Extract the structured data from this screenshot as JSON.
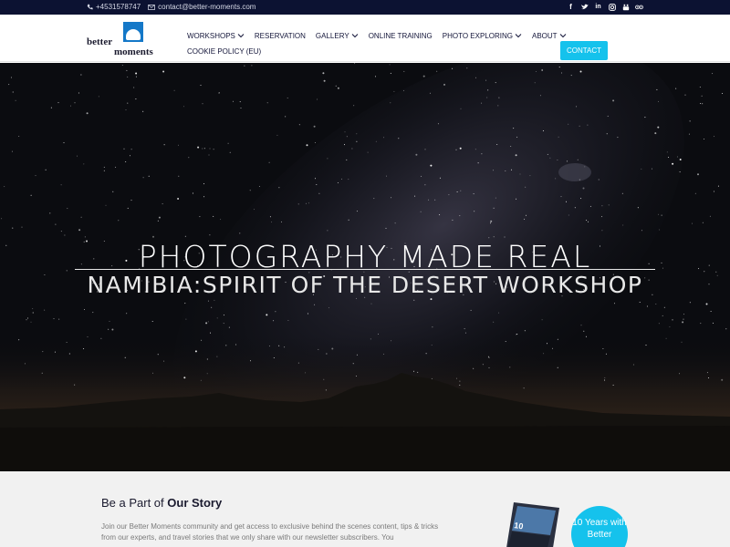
{
  "topbar": {
    "phone": "+4531578747",
    "email": "contact@better-moments.com",
    "socials": [
      "facebook-icon",
      "twitter-icon",
      "linkedin-icon",
      "instagram-icon",
      "youtube-icon",
      "tripadvisor-icon"
    ]
  },
  "logo": {
    "word1": "better",
    "word2": "moments"
  },
  "nav": {
    "items": [
      {
        "label": "WORKSHOPS",
        "dropdown": true
      },
      {
        "label": "RESERVATION",
        "dropdown": false
      },
      {
        "label": "GALLERY",
        "dropdown": true
      },
      {
        "label": "ONLINE TRAINING",
        "dropdown": false
      },
      {
        "label": "PHOTO EXPLORING",
        "dropdown": true
      },
      {
        "label": "ABOUT",
        "dropdown": true
      }
    ],
    "second_row": "COOKIE POLICY (EU)",
    "contact_label": "CONTACT"
  },
  "hero": {
    "title": "PHOTOGRAPHY MADE REAL",
    "subtitle": "NAMIBIA:SPIRIT OF THE DESERT WORKSHOP"
  },
  "story": {
    "title_prefix": "Be a Part of ",
    "title_bold": "Our Story",
    "text": "Join our Better Moments community and get access to exclusive behind the scenes content, tips & tricks from our experts, and travel stories that we only share with our newsletter subscribers. You",
    "badge": "10 Years with Better"
  },
  "colors": {
    "topbar_bg": "#0c1232",
    "accent": "#15c2ec",
    "brand_blue": "#1478c8",
    "text_dark": "#1a1a2e"
  }
}
